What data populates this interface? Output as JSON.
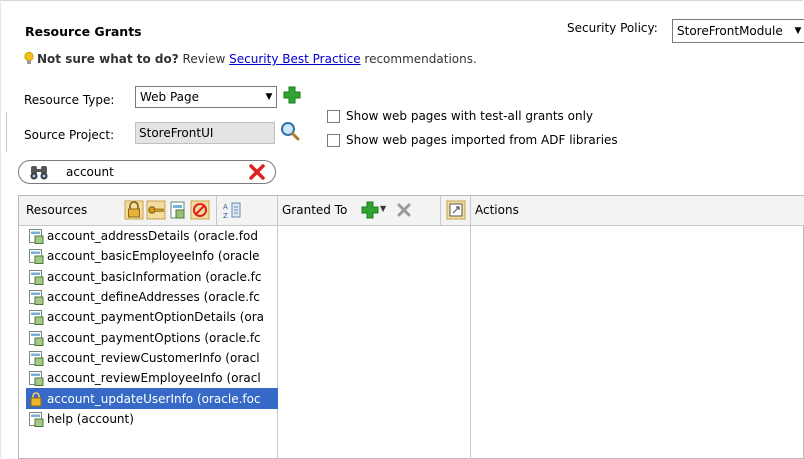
{
  "header": {
    "title": "Resource Grants",
    "security_policy_label": "Security Policy:",
    "security_policy_value": "StoreFrontModule"
  },
  "hint": {
    "bold": "Not sure what to do?",
    "pre": " Review ",
    "link": "Security Best Practice",
    "post": " recommendations."
  },
  "form": {
    "resource_type_label": "Resource Type:",
    "resource_type_value": "Web Page",
    "source_project_label": "Source Project:",
    "source_project_value": "StoreFrontUI",
    "checkbox_test_all": "Show web pages with test-all grants only",
    "checkbox_adf": "Show web pages imported from ADF libraries"
  },
  "filter": {
    "value": "account"
  },
  "table": {
    "col_resources": "Resources",
    "col_granted_to": "Granted To",
    "col_actions": "Actions",
    "rows": [
      {
        "label": "account_addressDetails (oracle.fod",
        "selected": false,
        "icon": "page-icon"
      },
      {
        "label": "account_basicEmployeeInfo (oracle",
        "selected": false,
        "icon": "page-icon"
      },
      {
        "label": "account_basicInformation (oracle.fc",
        "selected": false,
        "icon": "page-icon"
      },
      {
        "label": "account_defineAddresses (oracle.fc",
        "selected": false,
        "icon": "page-icon"
      },
      {
        "label": "account_paymentOptionDetails (ora",
        "selected": false,
        "icon": "page-icon"
      },
      {
        "label": "account_paymentOptions (oracle.fc",
        "selected": false,
        "icon": "page-icon"
      },
      {
        "label": "account_reviewCustomerInfo (oracl",
        "selected": false,
        "icon": "page-icon"
      },
      {
        "label": "account_reviewEmployeeInfo (oracl",
        "selected": false,
        "icon": "page-icon"
      },
      {
        "label": "account_updateUserInfo (oracle.foc",
        "selected": true,
        "icon": "lock-icon"
      },
      {
        "label": "help (account)",
        "selected": false,
        "icon": "page-icon"
      }
    ]
  },
  "colors": {
    "selection": "#3769c6",
    "link": "#0000cc",
    "add_green": "#2fa52f",
    "remove_red": "#e02020"
  }
}
